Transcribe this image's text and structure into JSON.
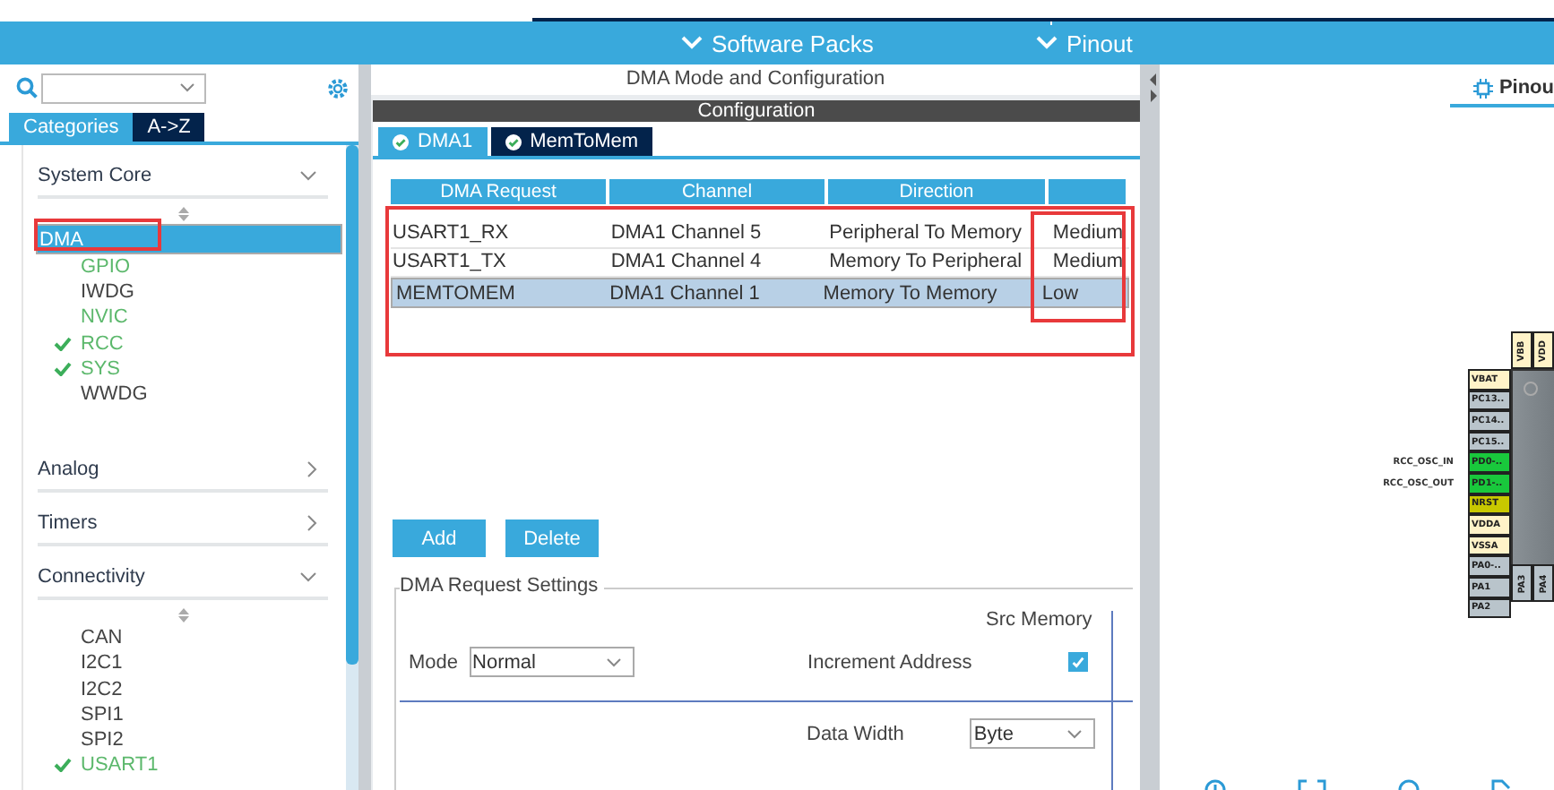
{
  "top_tabs": [
    {
      "label": "Software Packs"
    },
    {
      "label": "Pinout"
    }
  ],
  "sidebar": {
    "tabs": [
      {
        "label": "Categories",
        "selected": true
      },
      {
        "label": "A->Z",
        "selected": false
      }
    ],
    "categories": [
      {
        "label": "System Core",
        "expanded": true,
        "items": [
          {
            "label": "DMA",
            "selected": true,
            "configured": false,
            "checked": false
          },
          {
            "label": "GPIO",
            "selected": false,
            "configured": true,
            "checked": false
          },
          {
            "label": "IWDG",
            "selected": false,
            "configured": false,
            "checked": false
          },
          {
            "label": "NVIC",
            "selected": false,
            "configured": true,
            "checked": false
          },
          {
            "label": "RCC",
            "selected": false,
            "configured": true,
            "checked": true
          },
          {
            "label": "SYS",
            "selected": false,
            "configured": true,
            "checked": true
          },
          {
            "label": "WWDG",
            "selected": false,
            "configured": false,
            "checked": false
          }
        ]
      },
      {
        "label": "Analog",
        "expanded": false
      },
      {
        "label": "Timers",
        "expanded": false
      },
      {
        "label": "Connectivity",
        "expanded": true,
        "items": [
          {
            "label": "CAN",
            "selected": false,
            "configured": false,
            "checked": false
          },
          {
            "label": "I2C1",
            "selected": false,
            "configured": false,
            "checked": false
          },
          {
            "label": "I2C2",
            "selected": false,
            "configured": false,
            "checked": false
          },
          {
            "label": "SPI1",
            "selected": false,
            "configured": false,
            "checked": false
          },
          {
            "label": "SPI2",
            "selected": false,
            "configured": false,
            "checked": false
          },
          {
            "label": "USART1",
            "selected": false,
            "configured": true,
            "checked": true
          }
        ]
      }
    ]
  },
  "center": {
    "title": "DMA Mode and Configuration",
    "config_title": "Configuration",
    "tabs": [
      {
        "label": "DMA1",
        "selected": true
      },
      {
        "label": "MemToMem",
        "selected": false
      }
    ],
    "table": {
      "columns": [
        "DMA Request",
        "Channel",
        "Direction"
      ],
      "rows": [
        {
          "cells": [
            "USART1_RX",
            "DMA1 Channel 5",
            "Peripheral To Memory",
            "Medium"
          ],
          "selected": false
        },
        {
          "cells": [
            "USART1_TX",
            "DMA1 Channel 4",
            "Memory To Peripheral",
            "Medium"
          ],
          "selected": false
        },
        {
          "cells": [
            "MEMTOMEM",
            "DMA1 Channel 1",
            "Memory To Memory",
            "Low"
          ],
          "selected": true
        }
      ]
    },
    "buttons": [
      "Add",
      "Delete"
    ],
    "settings": {
      "title": "DMA Request Settings",
      "src_header": "Src Memory",
      "mode_label": "Mode",
      "mode_value": "Normal",
      "increment_label": "Increment Address",
      "increment_checked": true,
      "width_label": "Data Width",
      "width_value": "Byte"
    }
  },
  "pinout": {
    "tab": "Pinou",
    "top_pins": [
      {
        "label": "VBB",
        "color": "#fff3c8"
      },
      {
        "label": "VDD",
        "color": "#fff3c8"
      }
    ],
    "left_pins": [
      {
        "label": "VBAT",
        "color": "#fff3c8"
      },
      {
        "label": "PC13..",
        "color": "#b9c4cb"
      },
      {
        "label": "PC14..",
        "color": "#b9c4cb"
      },
      {
        "label": "PC15..",
        "color": "#b9c4cb"
      },
      {
        "label": "PD0-..",
        "color": "#19c83c",
        "signal": "RCC_OSC_IN"
      },
      {
        "label": "PD1-..",
        "color": "#19c83c",
        "signal": "RCC_OSC_OUT"
      },
      {
        "label": "NRST",
        "color": "#c8c800"
      },
      {
        "label": "VDDA",
        "color": "#fff3c8"
      },
      {
        "label": "VSSA",
        "color": "#fff3c8"
      },
      {
        "label": "PA0-..",
        "color": "#b9c4cb"
      },
      {
        "label": "PA1",
        "color": "#b9c4cb"
      },
      {
        "label": "PA2",
        "color": "#b9c4cb"
      }
    ],
    "bottom_pins": [
      {
        "label": "PA3",
        "color": "#b9c4cb"
      },
      {
        "label": "PA4",
        "color": "#b9c4cb"
      }
    ]
  }
}
